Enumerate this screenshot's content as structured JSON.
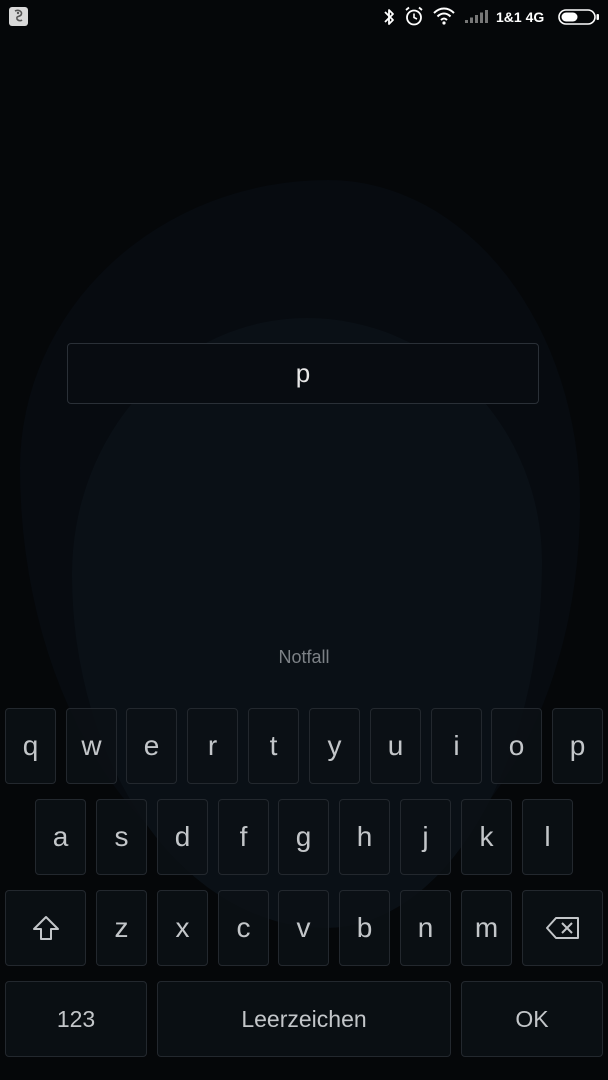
{
  "status_bar": {
    "carrier": "1&1 4G",
    "icons": [
      "app-notification-icon",
      "bluetooth-icon",
      "alarm-icon",
      "wifi-icon",
      "signal-icon",
      "battery-icon"
    ]
  },
  "pin_input": {
    "value": "p"
  },
  "emergency": {
    "label": "Notfall"
  },
  "keyboard": {
    "row1": [
      "q",
      "w",
      "e",
      "r",
      "t",
      "y",
      "u",
      "i",
      "o",
      "p"
    ],
    "row2": [
      "a",
      "s",
      "d",
      "f",
      "g",
      "h",
      "j",
      "k",
      "l"
    ],
    "row3": [
      "z",
      "x",
      "c",
      "v",
      "b",
      "n",
      "m"
    ],
    "shift_icon": "shift-icon",
    "backspace_icon": "backspace-icon",
    "numbers_label": "123",
    "space_label": "Leerzeichen",
    "ok_label": "OK"
  },
  "colors": {
    "background": "#050709",
    "key_border": "#23282e",
    "key_text": "#c3c6c9",
    "secondary_text": "#7c8186"
  }
}
